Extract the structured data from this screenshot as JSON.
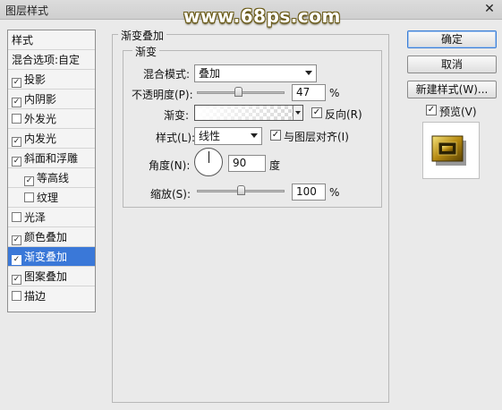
{
  "window": {
    "title": "图层样式",
    "close_label": "✕"
  },
  "watermark": "www.68ps.com",
  "sidebar": {
    "header": "样式",
    "blend_options": "混合选项:自定",
    "items": [
      {
        "label": "投影",
        "checked": true,
        "mark": "✓"
      },
      {
        "label": "内阴影",
        "checked": true,
        "mark": "✓"
      },
      {
        "label": "外发光",
        "checked": false,
        "mark": ""
      },
      {
        "label": "内发光",
        "checked": true,
        "mark": "✓"
      },
      {
        "label": "斜面和浮雕",
        "checked": true,
        "mark": "✓"
      },
      {
        "label": "等高线",
        "checked": true,
        "mark": "✓"
      },
      {
        "label": "纹理",
        "checked": false,
        "mark": ""
      },
      {
        "label": "光泽",
        "checked": false,
        "mark": ""
      },
      {
        "label": "颜色叠加",
        "checked": true,
        "mark": "✓"
      },
      {
        "label": "渐变叠加",
        "checked": true,
        "mark": "✓",
        "selected": true
      },
      {
        "label": "图案叠加",
        "checked": true,
        "mark": "✓"
      },
      {
        "label": "描边",
        "checked": false,
        "mark": ""
      }
    ]
  },
  "panel": {
    "title": "渐变叠加",
    "group_title": "渐变",
    "blend_mode_label": "混合模式:",
    "blend_mode_value": "叠加",
    "opacity_label": "不透明度(P):",
    "opacity_value": "47",
    "opacity_unit": "%",
    "opacity_fraction": 0.47,
    "gradient_label": "渐变:",
    "reverse_label": "反向(R)",
    "reverse_checked": true,
    "reverse_mark": "✓",
    "style_label": "样式(L):",
    "style_value": "线性",
    "align_label": "与图层对齐(I)",
    "align_checked": true,
    "align_mark": "✓",
    "angle_label": "角度(N):",
    "angle_value": "90",
    "angle_unit": "度",
    "scale_label": "缩放(S):",
    "scale_value": "100",
    "scale_unit": "%",
    "scale_fraction": 0.5
  },
  "buttons": {
    "ok": "确定",
    "cancel": "取消",
    "new_style": "新建样式(W)...",
    "preview_label": "预览(V)",
    "preview_checked": true,
    "preview_mark": "✓"
  },
  "colors": {
    "selection": "#3a78d8",
    "gold": "#c9a227"
  }
}
